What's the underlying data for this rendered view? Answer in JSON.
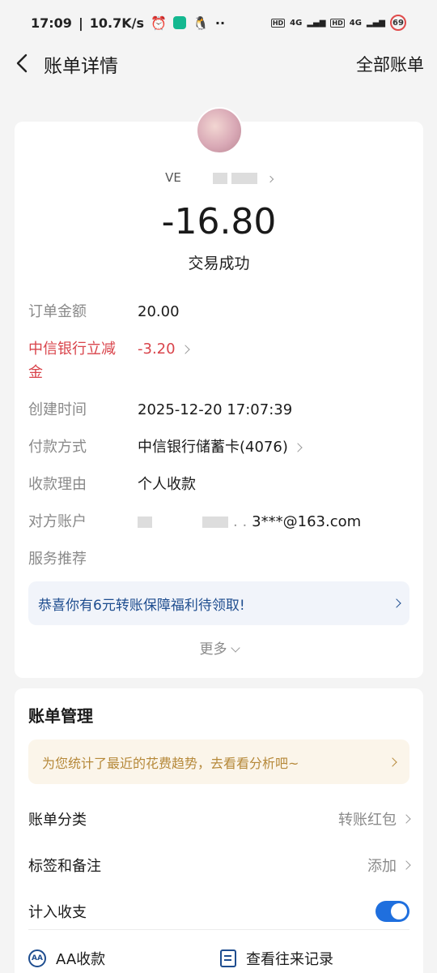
{
  "status_bar": {
    "time": "17:09",
    "net_speed": "10.7K/s",
    "hd": "HD",
    "signal": "4G",
    "battery": "69"
  },
  "nav": {
    "title": "账单详情",
    "right": "全部账单"
  },
  "payee": {
    "name_prefix": "VE",
    "mask_note": " "
  },
  "transaction": {
    "amount": "-16.80",
    "status": "交易成功"
  },
  "details": [
    {
      "label": "订单金额",
      "value": "20.00"
    },
    {
      "label": "中信银行立减金",
      "value": "-3.20"
    },
    {
      "label": "创建时间",
      "value": "2025-12-20 17:07:39"
    },
    {
      "label": "付款方式",
      "value": "中信银行储蓄卡(4076)"
    },
    {
      "label": "收款理由",
      "value": "个人收款"
    },
    {
      "label": "对方账户",
      "value": "3***@163.com"
    },
    {
      "label": "服务推荐",
      "value": ""
    }
  ],
  "promo": {
    "text": "恭喜你有6元转账保障福利待领取!"
  },
  "more_label": "更多",
  "management": {
    "title": "账单管理",
    "insight": "为您统计了最近的花费趋势，去看看分析吧~",
    "rows": [
      {
        "label": "账单分类",
        "value": "转账红包"
      },
      {
        "label": "标签和备注",
        "value": "添加"
      },
      {
        "label": "计入收支",
        "value": ""
      }
    ],
    "actions": [
      {
        "label": "AA收款"
      },
      {
        "label": "查看往来记录"
      }
    ],
    "aa_icon_text": "AA"
  },
  "colors": {
    "accent": "#1f6fde",
    "discount": "#d9444b",
    "insight_text": "#b6893a"
  }
}
